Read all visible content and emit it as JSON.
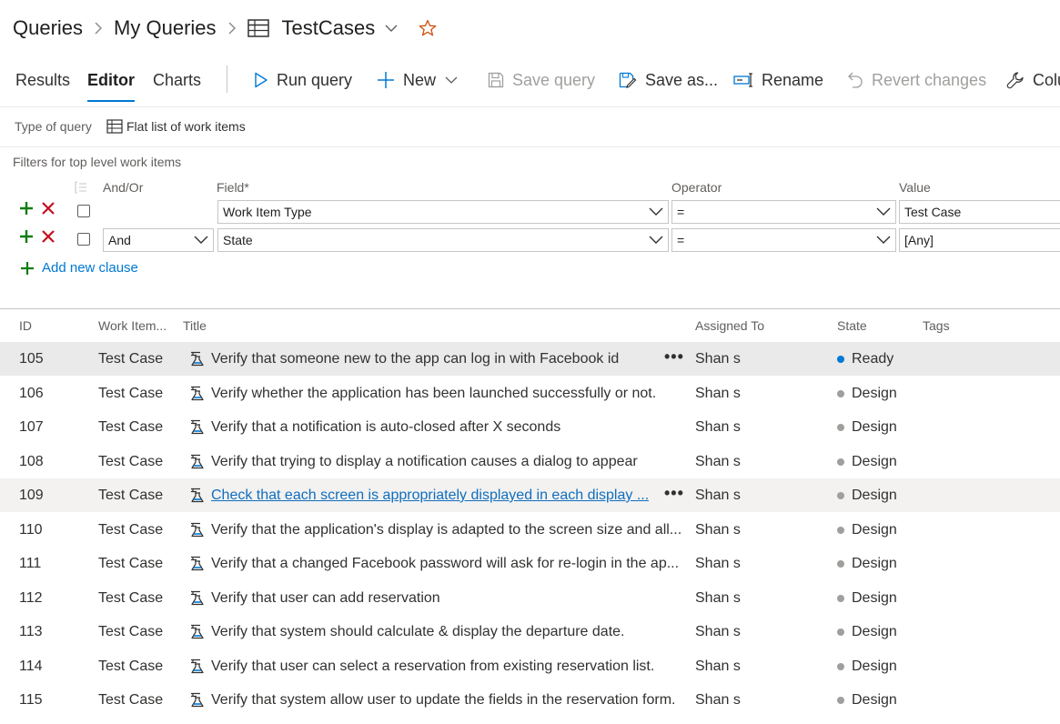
{
  "breadcrumb": {
    "root": "Queries",
    "folder": "My Queries",
    "query": "TestCases"
  },
  "tabs": [
    {
      "label": "Results"
    },
    {
      "label": "Editor"
    },
    {
      "label": "Charts"
    }
  ],
  "toolbar": {
    "run_query": "Run query",
    "new": "New",
    "save_query": "Save query",
    "save_as": "Save as...",
    "rename": "Rename",
    "revert": "Revert changes",
    "column_options": "Colu"
  },
  "query_type": {
    "label": "Type of query",
    "value": "Flat list of work items"
  },
  "filters": {
    "label": "Filters for top level work items",
    "headers": {
      "and_or": "And/Or",
      "field": "Field*",
      "operator": "Operator",
      "value": "Value"
    },
    "clauses": [
      {
        "and_or": "",
        "field": "Work Item Type",
        "operator": "=",
        "value": "Test Case"
      },
      {
        "and_or": "And",
        "field": "State",
        "operator": "=",
        "value": "[Any]"
      }
    ],
    "add_clause": "Add new clause"
  },
  "colors": {
    "accent": "#0078d4",
    "add_green": "#107c10",
    "remove_red": "#c50f1f",
    "ready_blue": "#0078d4",
    "design_gray": "#a19f9d",
    "favorite_orange": "#ca5010"
  },
  "results": {
    "columns": {
      "id": "ID",
      "type": "Work Item...",
      "title": "Title",
      "assigned": "Assigned To",
      "state": "State",
      "tags": "Tags"
    },
    "rows": [
      {
        "id": "105",
        "type": "Test Case",
        "title": "Verify that someone new to the app can log in with Facebook id",
        "assigned": "Shan s",
        "state": "Ready"
      },
      {
        "id": "106",
        "type": "Test Case",
        "title": "Verify whether the application has been launched successfully or not.",
        "assigned": "Shan s",
        "state": "Design"
      },
      {
        "id": "107",
        "type": "Test Case",
        "title": "Verify that a notification is auto-closed after X seconds",
        "assigned": "Shan s",
        "state": "Design"
      },
      {
        "id": "108",
        "type": "Test Case",
        "title": "Verify that trying to display a notification causes a dialog to appear",
        "assigned": "Shan s",
        "state": "Design"
      },
      {
        "id": "109",
        "type": "Test Case",
        "title": "Check that each screen is appropriately displayed in each display ...",
        "assigned": "Shan s",
        "state": "Design"
      },
      {
        "id": "110",
        "type": "Test Case",
        "title": "Verify that the application's display is adapted to the screen size and all...",
        "assigned": "Shan s",
        "state": "Design"
      },
      {
        "id": "111",
        "type": "Test Case",
        "title": "Verify that a changed Facebook password will ask for re-login in the ap...",
        "assigned": "Shan s",
        "state": "Design"
      },
      {
        "id": "112",
        "type": "Test Case",
        "title": "Verify that user can add reservation",
        "assigned": "Shan s",
        "state": "Design"
      },
      {
        "id": "113",
        "type": "Test Case",
        "title": "Verify that system should calculate & display the departure date.",
        "assigned": "Shan s",
        "state": "Design"
      },
      {
        "id": "114",
        "type": "Test Case",
        "title": "Verify that user can select a reservation from existing reservation list.",
        "assigned": "Shan s",
        "state": "Design"
      },
      {
        "id": "115",
        "type": "Test Case",
        "title": "Verify that system allow user to update the fields in the reservation form.",
        "assigned": "Shan s",
        "state": "Design"
      }
    ]
  }
}
